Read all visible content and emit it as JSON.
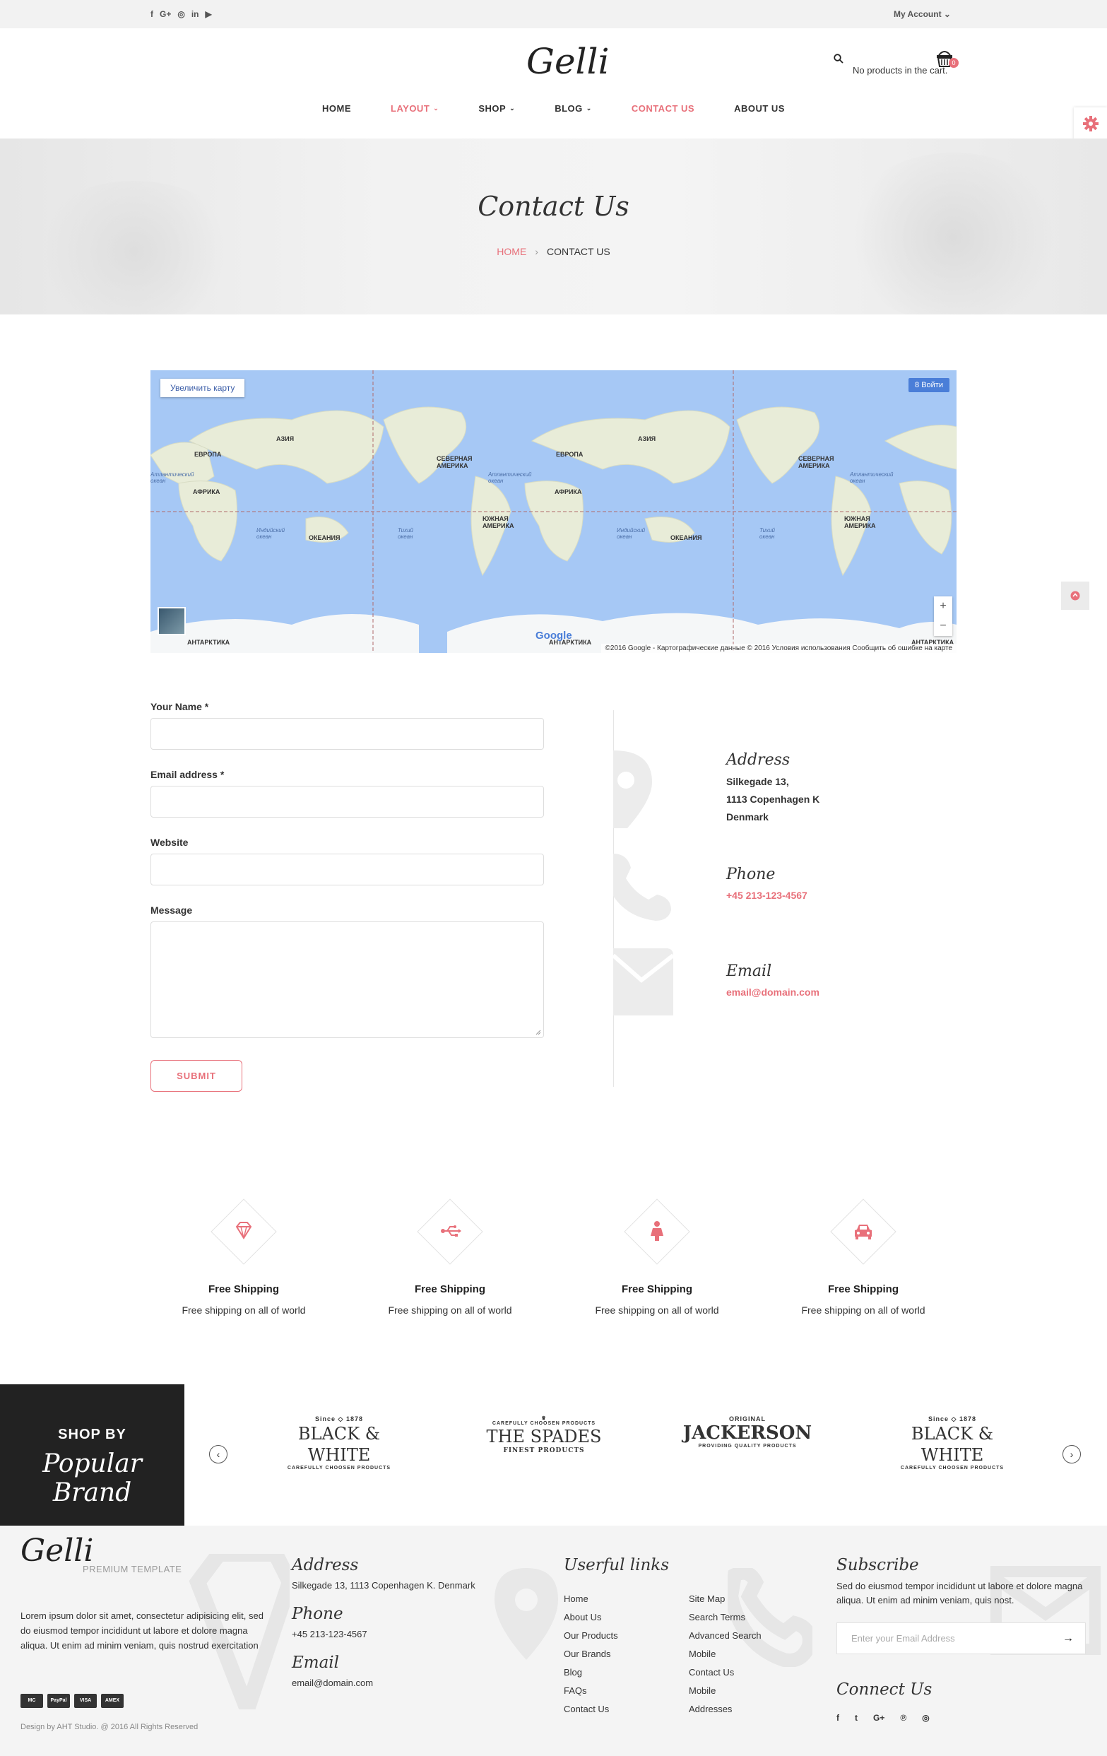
{
  "topbar": {
    "social": [
      "f",
      "G+",
      "◎",
      "in",
      "▶"
    ],
    "my_account": "My Account ⌄"
  },
  "header": {
    "logo": "Gelli",
    "cart_text": "No products in the cart.",
    "cart_count": "0"
  },
  "nav": [
    {
      "label": "HOME",
      "active": false,
      "dropdown": false
    },
    {
      "label": "LAYOUT",
      "active": true,
      "dropdown": true
    },
    {
      "label": "SHOP",
      "active": false,
      "dropdown": true
    },
    {
      "label": "BLOG",
      "active": false,
      "dropdown": true
    },
    {
      "label": "CONTACT US",
      "active": true,
      "dropdown": false
    },
    {
      "label": "ABOUT US",
      "active": false,
      "dropdown": false
    }
  ],
  "banner": {
    "title": "Contact Us",
    "breadcrumb_home": "HOME",
    "breadcrumb_sep": "›",
    "breadcrumb_current": "CONTACT US"
  },
  "map": {
    "enlarge_button": "Увеличить карту",
    "login_button": "8 Войти",
    "google": "Google",
    "footer": "©2016 Google - Картографические данные © 2016    Условия использования    Сообщить об ошибке на карте",
    "zoom_in": "+",
    "zoom_out": "−",
    "labels": [
      "ЕВРОПА",
      "АЗИЯ",
      "АФРИКА",
      "СЕВЕРНАЯ АМЕРИКА",
      "ЮЖНАЯ АМЕРИКА",
      "ОКЕАНИЯ",
      "АНТАРКТИКА",
      "ЕВРОПА",
      "АЗИЯ",
      "АФРИКА",
      "СЕВЕРНАЯ АМЕРИКА",
      "ЮЖНАЯ АМЕРИКА",
      "ОКЕАНИЯ",
      "АНТАРКТИКА",
      "АНТАРКТИКА"
    ],
    "oceans": [
      "Индийский океан",
      "Тихий океан",
      "Атлантический океан",
      "Индийский океан",
      "Тихий океан",
      "Атлантический океан",
      "Атлантический океан"
    ]
  },
  "form": {
    "name_label": "Your Name *",
    "email_label": "Email address *",
    "website_label": "Website",
    "message_label": "Message",
    "submit": "SUBMIT"
  },
  "contact": {
    "address_title": "Address",
    "address_lines": [
      "Silkegade 13,",
      "1113 Copenhagen K",
      "Denmark"
    ],
    "phone_title": "Phone",
    "phone": "+45 213-123-4567",
    "email_title": "Email",
    "email": "email@domain.com"
  },
  "features": [
    {
      "icon": "diamond-icon",
      "title": "Free Shipping",
      "text": "Free shipping on all of world"
    },
    {
      "icon": "usb-icon",
      "title": "Free Shipping",
      "text": "Free shipping on all of world"
    },
    {
      "icon": "person-icon",
      "title": "Free Shipping",
      "text": "Free shipping on all of world"
    },
    {
      "icon": "car-icon",
      "title": "Free Shipping",
      "text": "Free shipping on all of world"
    }
  ],
  "brands": {
    "shop_by": "SHOP BY",
    "popular": "Popular Brand",
    "items": [
      {
        "top": "Since ◇ 1878",
        "name": "BLACK & WHITE",
        "sub": "CAREFULLY CHOOSEN PRODUCTS"
      },
      {
        "top": "CAREFULLY CHOOSEN PRODUCTS",
        "name": "THE SPADES",
        "sub": "FINEST PRODUCTS"
      },
      {
        "top": "ORIGINAL",
        "name": "JACKERSON",
        "sub": "PROVIDING QUALITY PRODUCTS"
      },
      {
        "top": "Since ◇ 1878",
        "name": "BLACK & WHITE",
        "sub": "CAREFULLY CHOOSEN PRODUCTS"
      }
    ],
    "prev": "‹",
    "next": "›"
  },
  "footer": {
    "logo": "Gelli",
    "premium": "PREMIUM TEMPLATE",
    "about": "Lorem ipsum dolor sit amet, consectetur adipisicing elit, sed do eiusmod tempor incididunt ut labore et dolore magna aliqua. Ut enim ad minim veniam, quis nostrud exercitation",
    "payments": [
      "MC",
      "PayPal",
      "VISA",
      "AMEX"
    ],
    "copyright": "Design by AHT Studio. @ 2016 All Rights Reserved",
    "address_title": "Address",
    "address": "Silkegade 13, 1113 Copenhagen K. Denmark",
    "phone_title": "Phone",
    "phone": "+45 213-123-4567",
    "email_title": "Email",
    "email": "email@domain.com",
    "links_title": "Userful links",
    "links_col1": [
      "Home",
      "About Us",
      "Our Products",
      "Our Brands",
      "Blog",
      "FAQs",
      "Contact Us"
    ],
    "links_col2": [
      "Site Map",
      "Search Terms",
      "Advanced Search",
      "Mobile",
      "Contact Us",
      "Mobile",
      "Addresses"
    ],
    "subscribe_title": "Subscribe",
    "subscribe_text": "Sed do eiusmod tempor incididunt ut labore et dolore magna aliqua. Ut enim ad minim veniam, quis nost.",
    "subscribe_placeholder": "Enter your Email Address",
    "subscribe_arrow": "→",
    "connect_title": "Connect Us",
    "social": [
      "f",
      "t",
      "G+",
      "℗",
      "◎"
    ]
  },
  "colors": {
    "accent": "#e8707a",
    "dark": "#222222",
    "light_bg": "#f4f4f4"
  }
}
